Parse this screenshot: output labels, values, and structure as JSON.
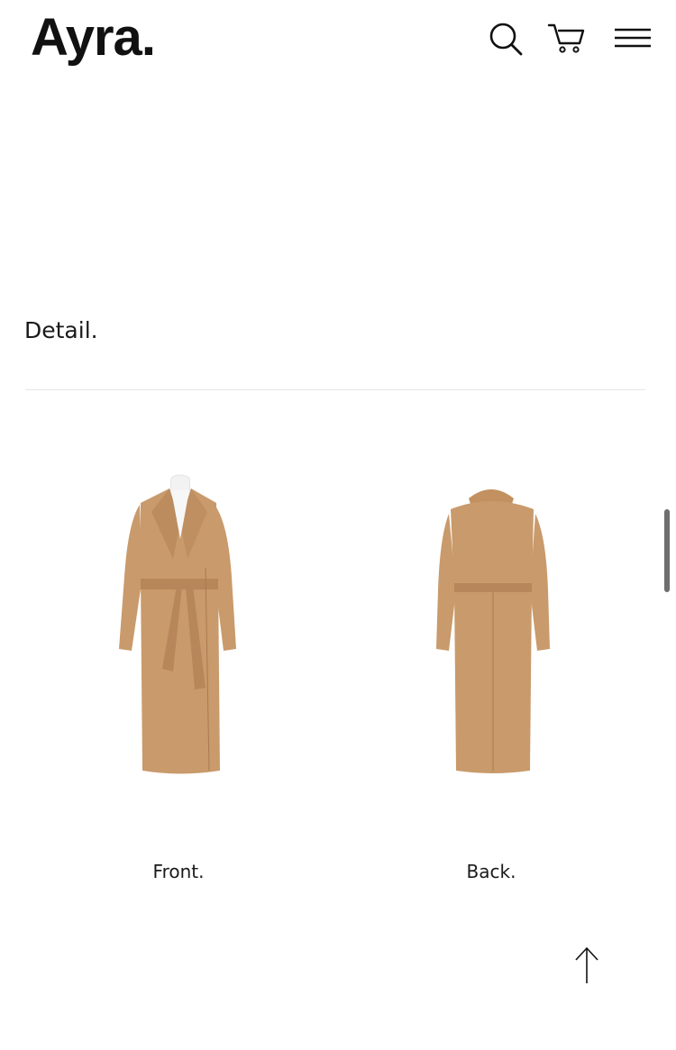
{
  "header": {
    "logo": "Ayra.",
    "icons": [
      "search-icon",
      "cart-icon",
      "hamburger-menu-icon"
    ]
  },
  "section": {
    "title": "Detail."
  },
  "products": {
    "front_caption": "Front.",
    "back_caption": "Back."
  },
  "colors": {
    "coat": "#C99A6B",
    "coat_shadow": "#B7865A",
    "divider": "#E6E6E6",
    "text": "#1A1A1A"
  },
  "floating": {
    "scroll_top_icon": "arrow-up-icon"
  }
}
